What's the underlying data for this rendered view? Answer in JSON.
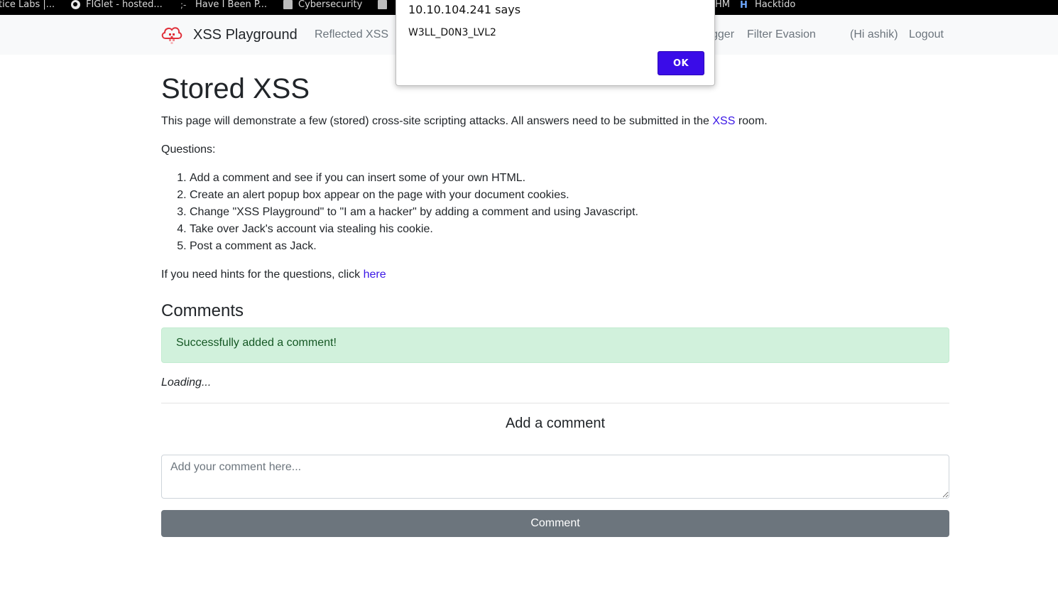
{
  "bookmarks": [
    {
      "label": "tice Labs |...",
      "icon": "none"
    },
    {
      "label": "FIGlet - hosted...",
      "icon": "globe-icon"
    },
    {
      "label": "Have I Been P...",
      "icon": "pwned-icon"
    },
    {
      "label": "Cybersecurity",
      "icon": "folder-icon"
    },
    {
      "label": "",
      "icon": "folder-icon"
    },
    {
      "label": "HM",
      "icon": "none"
    },
    {
      "label": "Hacktido",
      "icon": "h-icon"
    }
  ],
  "navbar": {
    "brand": "XSS Playground",
    "logo_icon": "cloud-logo-icon",
    "links": {
      "reflected": "Reflected XSS",
      "logger": "gger",
      "filter": "Filter Evasion",
      "greeting": "(Hi ashik)",
      "logout": "Logout"
    }
  },
  "main": {
    "title": "Stored XSS",
    "intro_before": "This page will demonstrate a few (stored) cross-site scripting attacks. All answers need to be submitted in the ",
    "intro_link": "XSS",
    "intro_after": " room.",
    "questions_label": "Questions:",
    "questions": [
      "Add a comment and see if you can insert some of your own HTML.",
      "Create an alert popup box appear on the page with your document cookies.",
      "Change \"XSS Playground\" to \"I am a hacker\" by adding a comment and using Javascript.",
      "Take over Jack's account via stealing his cookie.",
      "Post a comment as Jack."
    ],
    "hint_text": "If you need hints for the questions, click ",
    "hint_link": "here"
  },
  "comments": {
    "heading": "Comments",
    "success": "Successfully added a comment!",
    "loading": "Loading...",
    "add_heading": "Add a comment",
    "placeholder": "Add your comment here...",
    "button": "Comment"
  },
  "dialog": {
    "title": "10.10.104.241 says",
    "message": "W3LL_D0N3_LVL2",
    "ok": "OK"
  },
  "colors": {
    "link": "#3a16e6",
    "ok_button": "#3a0ce8",
    "success_bg": "#d1f1dc",
    "comment_button": "#6c757d",
    "logo": "#e0303a"
  }
}
